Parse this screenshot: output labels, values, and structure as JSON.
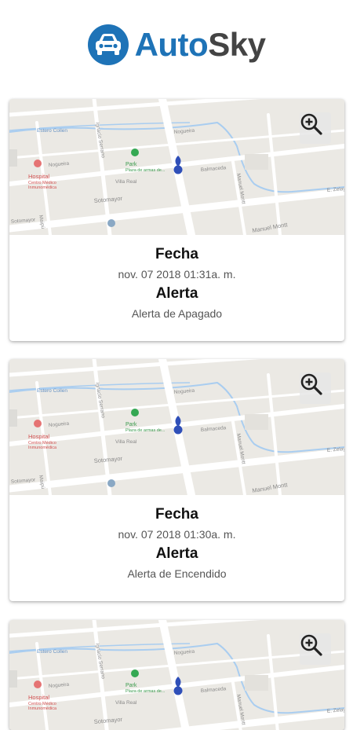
{
  "app": {
    "brand_part1": "Auto",
    "brand_part2": "Sky",
    "brand_color": "#1e73b7",
    "logo_icon": "car-icon"
  },
  "map_labels": {
    "street_1": "Nogueira",
    "street_2": "Estero Collen",
    "street_3": "Ignacio Serrano",
    "street_4": "Nogueira",
    "street_5": "Villa Real",
    "street_6": "Sotomayor",
    "street_7": "Balmaceda",
    "street_8": "Manuel Montt",
    "street_9": "Manuel Montt",
    "street_10": "E. Zelaya",
    "street_11": "Maipú",
    "street_12": "Sotomayor",
    "poi_park": "Park",
    "poi_park_sub": "Plaza de armas de...",
    "poi_hospital": "Hospital",
    "poi_hospital_sub1": "Centro Médico",
    "poi_hospital_sub2": "Inmunomédica"
  },
  "zoom_icon": "zoom-in-icon",
  "cards": [
    {
      "date_label": "Fecha",
      "date_value": "nov. 07 2018 01:31a. m.",
      "alert_label": "Alerta",
      "alert_value": "Alerta de Apagado"
    },
    {
      "date_label": "Fecha",
      "date_value": "nov. 07 2018 01:30a. m.",
      "alert_label": "Alerta",
      "alert_value": "Alerta de Encendido"
    },
    {
      "date_label": "",
      "date_value": "",
      "alert_label": "",
      "alert_value": ""
    }
  ]
}
